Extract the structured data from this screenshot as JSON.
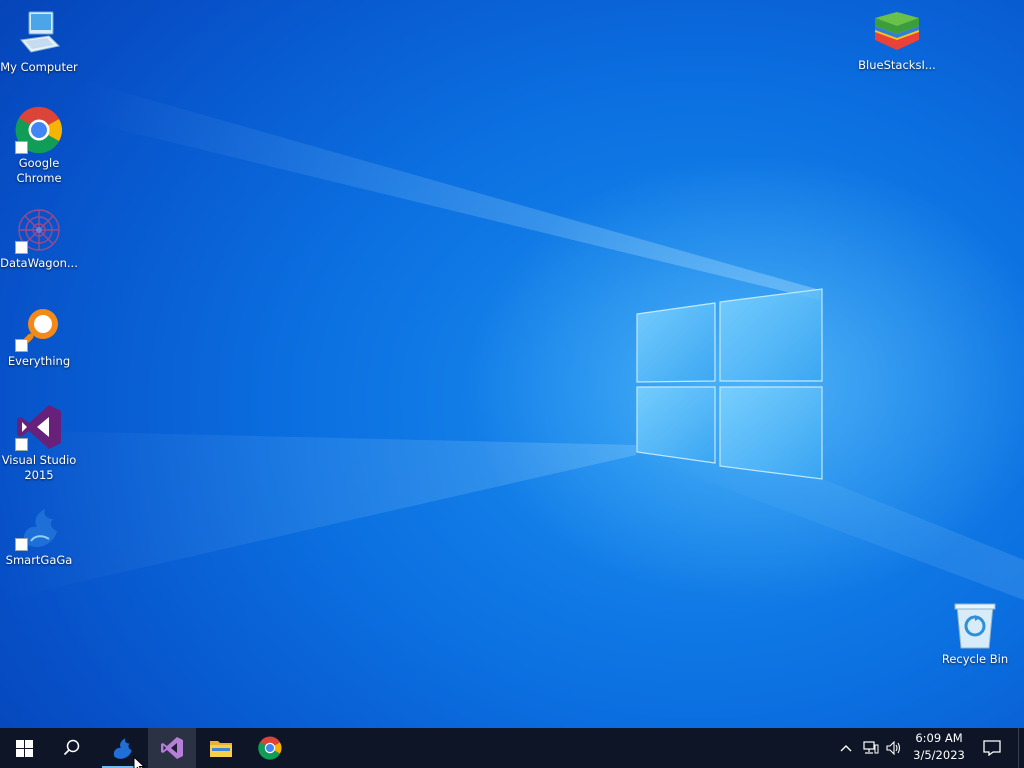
{
  "desktop": {
    "icons_left": [
      {
        "label_line1": "My Computer",
        "label_line2": "",
        "icon": "computer-icon"
      },
      {
        "label_line1": "Google",
        "label_line2": "Chrome",
        "icon": "chrome-icon"
      },
      {
        "label_line1": "DataWagon...",
        "label_line2": "",
        "icon": "datawagon-icon"
      },
      {
        "label_line1": "Everything",
        "label_line2": "",
        "icon": "everything-search-icon"
      },
      {
        "label_line1": "Visual Studio",
        "label_line2": "2015",
        "icon": "visual-studio-icon"
      },
      {
        "label_line1": "SmartGaGa",
        "label_line2": "",
        "icon": "smartgaga-icon"
      }
    ],
    "bluestacks": {
      "label": "BlueStacksI...",
      "icon": "bluestacks-icon"
    },
    "recycle_bin": {
      "label": "Recycle Bin",
      "icon": "recycle-bin-icon"
    }
  },
  "taskbar": {
    "start_icon": "windows-start-icon",
    "search_icon": "search-icon",
    "pinned": [
      {
        "name": "SmartGaGa",
        "icon": "smartgaga-icon",
        "running": true
      },
      {
        "name": "Visual Studio",
        "icon": "visual-studio-icon",
        "running": false
      },
      {
        "name": "File Explorer",
        "icon": "file-explorer-icon",
        "running": false
      },
      {
        "name": "Google Chrome",
        "icon": "chrome-icon",
        "running": false
      }
    ],
    "tray": {
      "time": "6:09 AM",
      "date": "3/5/2023"
    }
  },
  "colors": {
    "taskbar_bg": "#0e1526",
    "accent": "#76b9ed",
    "desktop_blue": "#0b6fe0"
  }
}
